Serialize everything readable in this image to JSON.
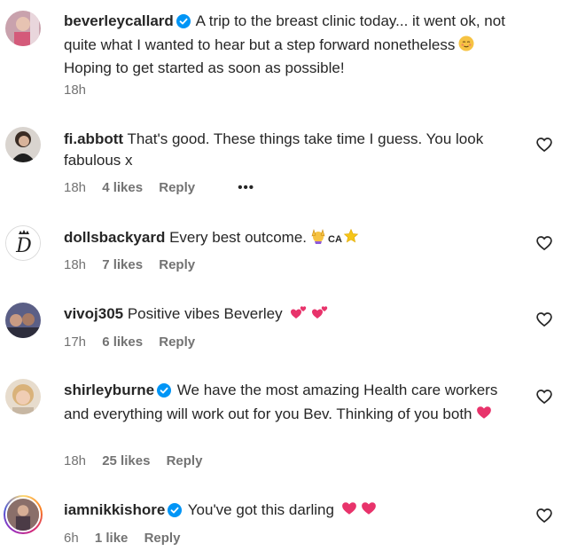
{
  "comments": [
    {
      "username": "beverleycallard",
      "verified": true,
      "text": "A trip to the breast clinic today... it went ok, not quite what I wanted to hear but a step forward nonetheless",
      "text_after": "Hoping to get started as soon as possible!",
      "emoji": "relieved-face-emoji",
      "time": "18h",
      "likes": "",
      "reply": ""
    },
    {
      "username": "fi.abbott",
      "verified": false,
      "text": "That's good. These things take time I guess. You look fabulous x",
      "time": "18h",
      "likes": "4 likes",
      "reply": "Reply",
      "more": "•••"
    },
    {
      "username": "dollsbackyard",
      "verified": false,
      "text": "Every best outcome.",
      "ca_label": "CA",
      "time": "18h",
      "likes": "7 likes",
      "reply": "Reply"
    },
    {
      "username": "vivoj305",
      "verified": false,
      "text": "Positive vibes Beverley",
      "time": "17h",
      "likes": "6 likes",
      "reply": "Reply"
    },
    {
      "username": "shirleyburne",
      "verified": true,
      "text": "We have the most amazing Health care workers and everything will work out for you Bev. Thinking of you both",
      "time": "18h",
      "likes": "25 likes",
      "reply": "Reply"
    },
    {
      "username": "iamnikkishore",
      "verified": true,
      "text": "You've got this darling",
      "time": "6h",
      "likes": "1 like",
      "reply": "Reply"
    }
  ],
  "colors": {
    "verified": "#0095f6",
    "meta": "#737373",
    "heart_emoji": "#e8336b",
    "text": "#262626"
  }
}
